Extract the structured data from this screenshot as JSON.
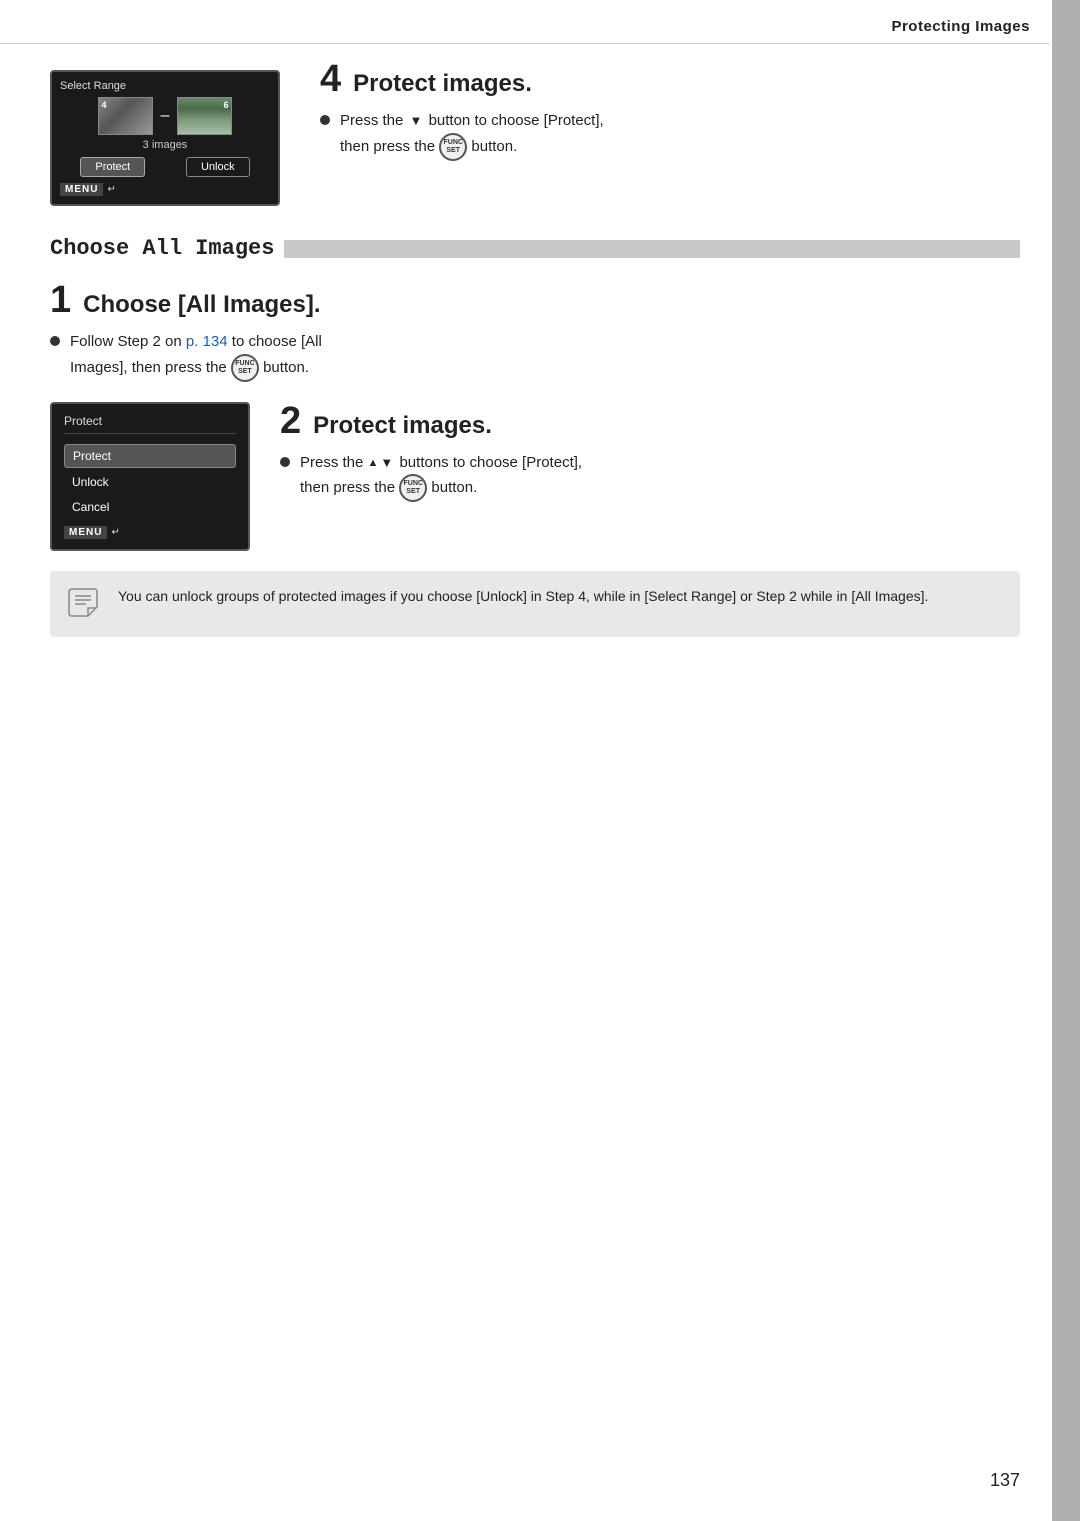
{
  "header": {
    "title": "Protecting Images"
  },
  "step4": {
    "number": "4",
    "title": "Protect images.",
    "screen": {
      "label": "Select Range",
      "left_num": "4",
      "right_num": "6",
      "count": "3 images",
      "btn_protect": "Protect",
      "btn_unlock": "Unlock",
      "menu_label": "MENU"
    },
    "bullet": "Press the",
    "bullet_mid": "button to choose [Protect],",
    "bullet_end": "then press the",
    "bullet_final": "button."
  },
  "section": {
    "title": "Choose All Images"
  },
  "step1": {
    "number": "1",
    "title": "Choose [All Images].",
    "bullet_start": "Follow Step 2 on",
    "page_link": "p. 134",
    "bullet_mid": "to choose [All",
    "bullet_end": "Images], then press the",
    "bullet_final": "button."
  },
  "step2": {
    "number": "2",
    "title": "Protect images.",
    "screen": {
      "label": "Protect",
      "item_protect": "Protect",
      "item_unlock": "Unlock",
      "item_cancel": "Cancel",
      "menu_label": "MENU"
    },
    "bullet": "Press the",
    "bullet_mid": "buttons to choose [Protect],",
    "bullet_end": "then press the",
    "bullet_final": "button."
  },
  "note": {
    "text": "You can unlock groups of protected images if you choose [Unlock] in Step 4, while in [Select Range] or Step 2 while in [All Images]."
  },
  "page_number": "137"
}
